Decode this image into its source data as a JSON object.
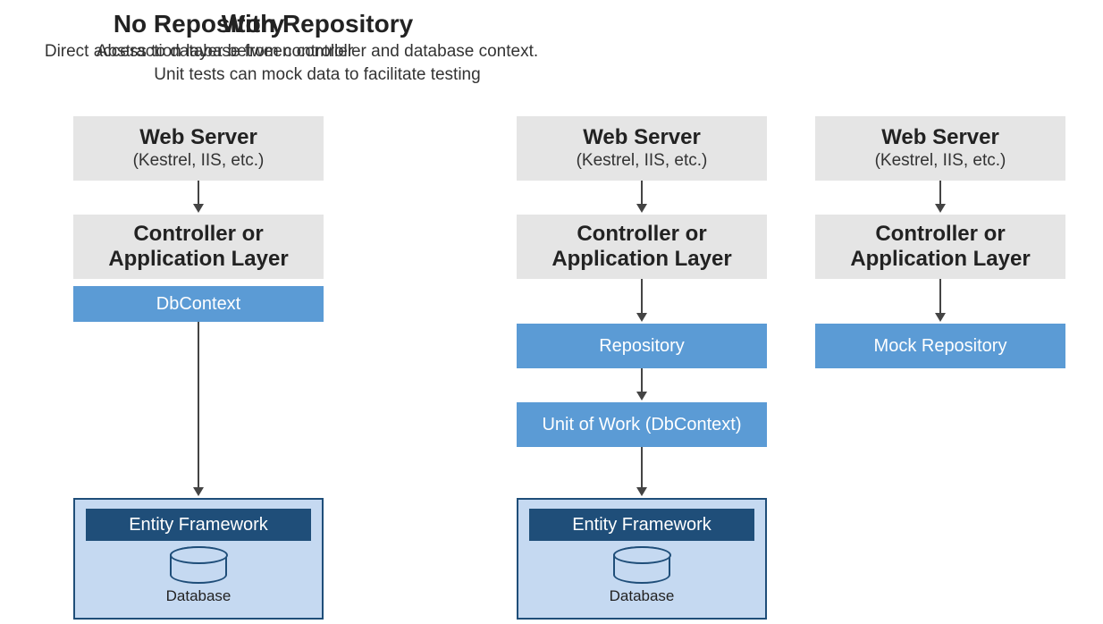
{
  "left": {
    "title": "No Repository",
    "subtitle": "Direct access to database from controller",
    "webserver_title": "Web Server",
    "webserver_sub": "(Kestrel, IIS, etc.)",
    "controller_l1": "Controller or",
    "controller_l2": "Application Layer",
    "dbcontext": "DbContext",
    "ef": "Entity Framework",
    "database": "Database"
  },
  "right": {
    "title": "With Repository",
    "subtitle_l1": "Abstraction layer between controller and database context.",
    "subtitle_l2": "Unit tests can mock data to facilitate testing",
    "colA": {
      "webserver_title": "Web Server",
      "webserver_sub": "(Kestrel, IIS, etc.)",
      "controller_l1": "Controller or",
      "controller_l2": "Application Layer",
      "repository": "Repository",
      "uow": "Unit of Work (DbContext)",
      "ef": "Entity Framework",
      "database": "Database"
    },
    "colB": {
      "webserver_title": "Web Server",
      "webserver_sub": "(Kestrel, IIS, etc.)",
      "controller_l1": "Controller or",
      "controller_l2": "Application Layer",
      "mock": "Mock Repository"
    }
  },
  "colors": {
    "gray": "#e5e5e5",
    "blue": "#5b9bd5",
    "darkblue": "#1f4e79",
    "lightblue": "#c5d9f1"
  }
}
